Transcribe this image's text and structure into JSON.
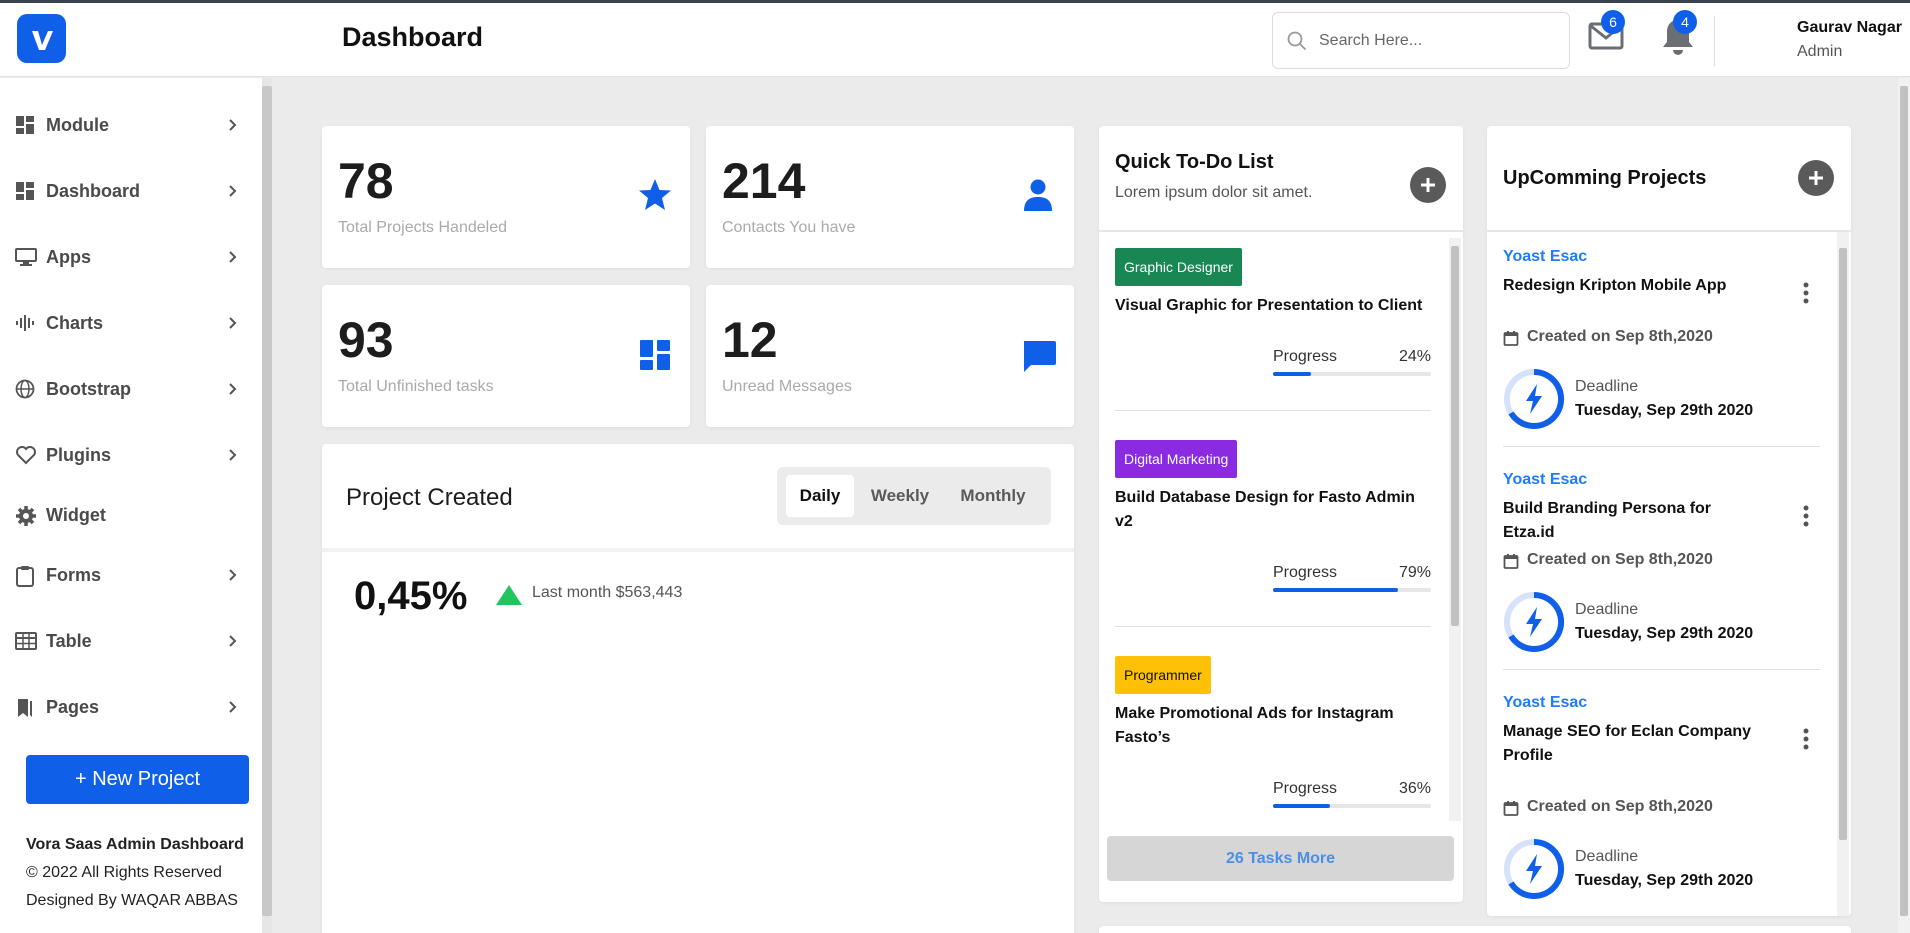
{
  "header": {
    "title": "Dashboard",
    "search_placeholder": "Search Here...",
    "mail_count": "6",
    "notification_count": "4",
    "user_name": "Gaurav Nagar",
    "user_role": "Admin",
    "logo_icon": "vimeo-v-logo"
  },
  "sidebar": {
    "items": [
      {
        "label": "Module",
        "icon": "module-grid-icon"
      },
      {
        "label": "Dashboard",
        "icon": "dashboard-grid-icon"
      },
      {
        "label": "Apps",
        "icon": "monitor-icon"
      },
      {
        "label": "Charts",
        "icon": "chart-bars-icon"
      },
      {
        "label": "Bootstrap",
        "icon": "globe-icon"
      },
      {
        "label": "Plugins",
        "icon": "heart-icon"
      },
      {
        "label": "Widget",
        "icon": "gear-icon"
      },
      {
        "label": "Forms",
        "icon": "clipboard-icon"
      },
      {
        "label": "Table",
        "icon": "table-icon"
      },
      {
        "label": "Pages",
        "icon": "bookmark-icon"
      }
    ],
    "new_project_label": "+ New Project",
    "footer_title": "Vora Saas Admin Dashboard",
    "footer_copyright": "© 2022 All Rights Reserved",
    "footer_designed": "Designed By WAQAR ABBAS"
  },
  "stats": [
    {
      "value": "78",
      "label": "Total Projects Handeled",
      "icon": "star-icon"
    },
    {
      "value": "214",
      "label": "Contacts You have",
      "icon": "user-icon"
    },
    {
      "value": "93",
      "label": "Total Unfinished tasks",
      "icon": "dashboard-tiles-icon"
    },
    {
      "value": "12",
      "label": "Unread Messages",
      "icon": "message-icon"
    }
  ],
  "project_created": {
    "title": "Project Created",
    "tabs": [
      "Daily",
      "Weekly",
      "Monthly"
    ],
    "active_tab": "Daily",
    "percent": "0,45%",
    "last_month": "Last month $563,443"
  },
  "todo": {
    "title": "Quick To-Do List",
    "subtitle": "Lorem ipsum dolor sit amet.",
    "progress_label": "Progress",
    "tasks": [
      {
        "tag": "Graphic Designer",
        "tag_color": "#198754",
        "title": "Visual Graphic for Presentation to Client",
        "progress": "24%",
        "progress_value": 24
      },
      {
        "tag": "Digital Marketing",
        "tag_color": "#8a2be2",
        "title": "Build Database Design for Fasto Admin v2",
        "progress": "79%",
        "progress_value": 79
      },
      {
        "tag": "Programmer",
        "tag_color": "#ffc107",
        "title": "Make Promotional Ads for Instagram Fasto’s",
        "progress": "36%",
        "progress_value": 36
      }
    ],
    "more_label": "26 Tasks More"
  },
  "upcoming": {
    "title": "UpComming Projects",
    "projects": [
      {
        "client": "Yoast Esac",
        "name": "Redesign Kripton Mobile App",
        "created": "Created on Sep 8th,2020",
        "deadline_label": "Deadline",
        "deadline": "Tuesday, Sep 29th 2020"
      },
      {
        "client": "Yoast Esac",
        "name": "Build Branding Persona for Etza.id",
        "created": "Created on Sep 8th,2020",
        "deadline_label": "Deadline",
        "deadline": "Tuesday, Sep 29th 2020"
      },
      {
        "client": "Yoast Esac",
        "name": "Manage SEO for Eclan Company Profile",
        "created": "Created on Sep 8th,2020",
        "deadline_label": "Deadline",
        "deadline": "Tuesday, Sep 29th 2020"
      }
    ]
  },
  "colors": {
    "accent": "#0f5fe8",
    "link": "#1f7cff",
    "up_triangle": "#22c55e"
  }
}
